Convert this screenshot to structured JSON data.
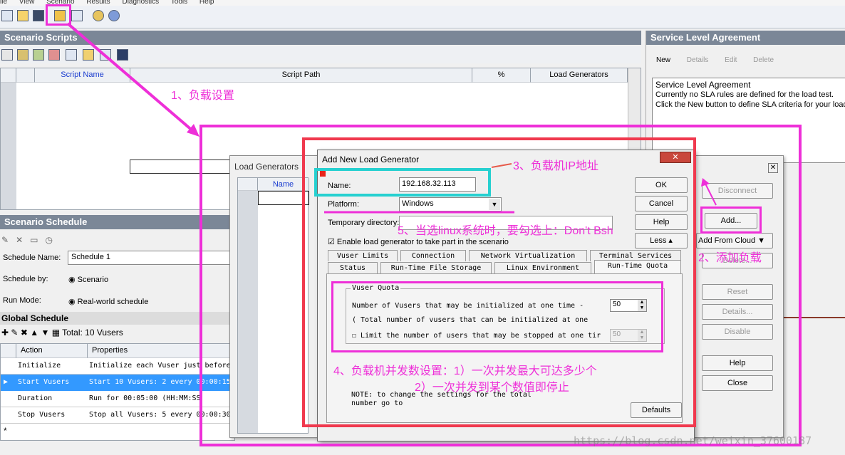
{
  "menu": [
    "ile",
    "View",
    "Scenario",
    "Results",
    "Diagnostics",
    "Tools",
    "Help"
  ],
  "scenario_scripts": {
    "title": "Scenario Scripts",
    "columns": [
      "Script Name",
      "Script Path",
      "%",
      "Load Generators"
    ]
  },
  "sla": {
    "title": "Service Level Agreement",
    "toolbar": [
      "New",
      "Details",
      "Edit",
      "Delete"
    ],
    "box_title": "Service Level Agreement",
    "line1": "Currently no SLA rules are defined for the load test.",
    "line2": "Click the New button to define SLA criteria for your load"
  },
  "load_generators_window": {
    "title": "Load Generators",
    "name_col": "Name",
    "buttons": {
      "disconnect": "Disconnect",
      "add": "Add...",
      "add_cloud": "Add From Cloud",
      "delete": "Delete...",
      "reset": "Reset",
      "details": "Details...",
      "disable": "Disable",
      "help": "Help",
      "close": "Close"
    }
  },
  "schedule": {
    "title": "Scenario Schedule",
    "schedule_name_label": "Schedule Name:",
    "schedule_name_value": "Schedule 1",
    "schedule_by_label": "Schedule by:",
    "schedule_by_value": "Scenario",
    "run_mode_label": "Run Mode:",
    "run_mode_value": "Real-world schedule",
    "global_title": "Global Schedule",
    "total": "Total: 10 Vusers",
    "columns": [
      "Action",
      "Properties"
    ],
    "rows": [
      {
        "action": "Initialize",
        "props": "Initialize each Vuser just before"
      },
      {
        "action": "Start  Vusers",
        "props": "Start 10 Vusers: 2 every 00:00:15"
      },
      {
        "action": "Duration",
        "props": "Run for 00:05:00 (HH:MM:SS"
      },
      {
        "action": "Stop Vusers",
        "props": "Stop all Vusers: 5 every 00:00:30"
      }
    ],
    "new_row": "*"
  },
  "dialog": {
    "title": "Add New Load Generator",
    "name_label": "Name:",
    "name_value": "192.168.32.113",
    "platform_label": "Platform:",
    "platform_value": "Windows",
    "tempdir_label": "Temporary directory:",
    "enable_label": "Enable load generator to take part in the scenario",
    "ok": "OK",
    "cancel": "Cancel",
    "help": "Help",
    "less": "Less",
    "tabs_row1": [
      "Vuser Limits",
      "Connection",
      "Network Virtualization",
      "Terminal Services"
    ],
    "tabs_row2": [
      "Status",
      "Run-Time File Storage",
      "Linux Environment",
      "Run-Time Quota"
    ],
    "quota_group": "Vuser Quota",
    "quota_line1": "Number of Vusers that may be initialized at one time -",
    "quota_line2": "( Total number of vusers that can be initialized at one",
    "quota_line3": "Limit the number of users that may be stopped at one tir",
    "quota_val1": "50",
    "quota_val2": "50",
    "note1": "NOTE: to change the settings for the total",
    "note2": "number go to",
    "defaults": "Defaults"
  },
  "annotations": {
    "a1": "1、负载设置",
    "a2": "2、添加负载",
    "a3": "3、负载机IP地址",
    "a4": "4、负载机并发数设置：1）一次并发最大可达多少个",
    "a4b": "2）一次并发到某个数值即停止",
    "a5": "5、当选linux系统时，要勾选上：Don't Bsh"
  },
  "watermark": "https://blog.csdn.net/weixin_37600187",
  "colors": {
    "annotation": "#ee2fd8",
    "red_box": "#f0394e",
    "cyan_box": "#26d0d0",
    "selected_row": "#3399ff"
  }
}
